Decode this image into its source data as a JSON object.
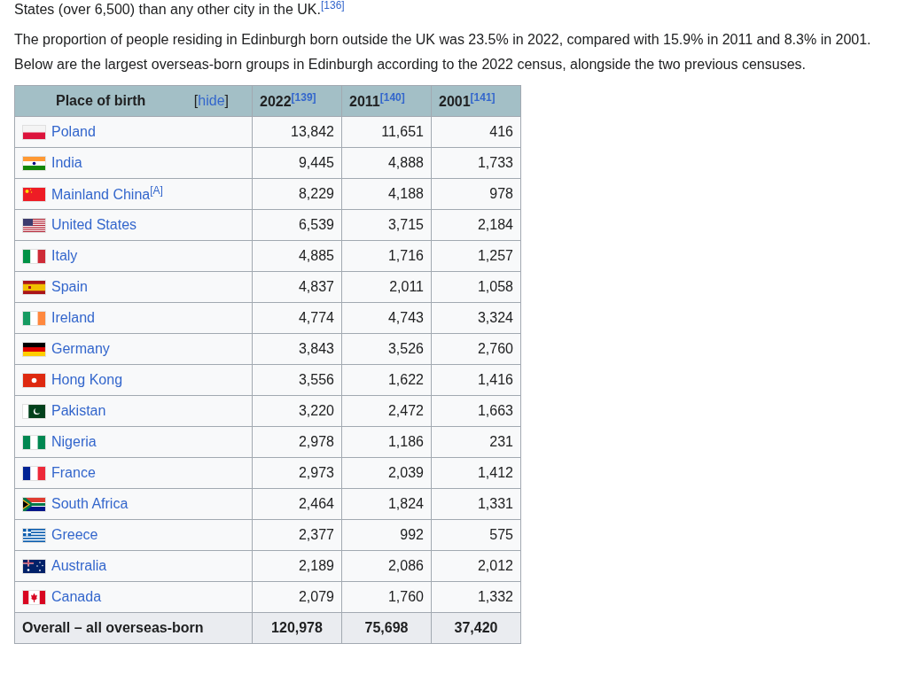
{
  "paragraphs": [
    {
      "text": "States (over 6,500) than any other city in the UK.",
      "ref": "[136]"
    },
    {
      "text": "The proportion of people residing in Edinburgh born outside the UK was 23.5% in 2022, compared with 15.9% in 2011 and 8.3% in 2001. Below are the largest overseas-born groups in Edinburgh according to the 2022 census, alongside the two previous censuses."
    }
  ],
  "table": {
    "header": {
      "place": "Place of birth",
      "toggle": "[hide]",
      "years": [
        {
          "year": "2022",
          "ref": "[139]"
        },
        {
          "year": "2011",
          "ref": "[140]"
        },
        {
          "year": "2001",
          "ref": "[141]"
        }
      ]
    },
    "rows": [
      {
        "kind": "pl",
        "country": "Poland",
        "values": [
          "13,842",
          "11,651",
          "416"
        ]
      },
      {
        "kind": "in",
        "country": "India",
        "values": [
          "9,445",
          "4,888",
          "1,733"
        ]
      },
      {
        "kind": "cn",
        "country": "Mainland China",
        "note": "[A]",
        "values": [
          "8,229",
          "4,188",
          "978"
        ]
      },
      {
        "kind": "us",
        "country": "United States",
        "values": [
          "6,539",
          "3,715",
          "2,184"
        ]
      },
      {
        "kind": "it",
        "country": "Italy",
        "values": [
          "4,885",
          "1,716",
          "1,257"
        ]
      },
      {
        "kind": "es",
        "country": "Spain",
        "values": [
          "4,837",
          "2,011",
          "1,058"
        ]
      },
      {
        "kind": "ie",
        "country": "Ireland",
        "values": [
          "4,774",
          "4,743",
          "3,324"
        ]
      },
      {
        "kind": "de",
        "country": "Germany",
        "values": [
          "3,843",
          "3,526",
          "2,760"
        ]
      },
      {
        "kind": "hk",
        "country": "Hong Kong",
        "values": [
          "3,556",
          "1,622",
          "1,416"
        ]
      },
      {
        "kind": "pk",
        "country": "Pakistan",
        "values": [
          "3,220",
          "2,472",
          "1,663"
        ]
      },
      {
        "kind": "ng",
        "country": "Nigeria",
        "values": [
          "2,978",
          "1,186",
          "231"
        ]
      },
      {
        "kind": "fr",
        "country": "France",
        "values": [
          "2,973",
          "2,039",
          "1,412"
        ]
      },
      {
        "kind": "za",
        "country": "South Africa",
        "values": [
          "2,464",
          "1,824",
          "1,331"
        ]
      },
      {
        "kind": "gr",
        "country": "Greece",
        "values": [
          "2,377",
          "992",
          "575"
        ]
      },
      {
        "kind": "au",
        "country": "Australia",
        "values": [
          "2,189",
          "2,086",
          "2,012"
        ]
      },
      {
        "kind": "ca",
        "country": "Canada",
        "values": [
          "2,079",
          "1,760",
          "1,332"
        ]
      }
    ],
    "footer": {
      "label": "Overall – all overseas-born",
      "values": [
        "120,978",
        "75,698",
        "37,420"
      ]
    }
  }
}
